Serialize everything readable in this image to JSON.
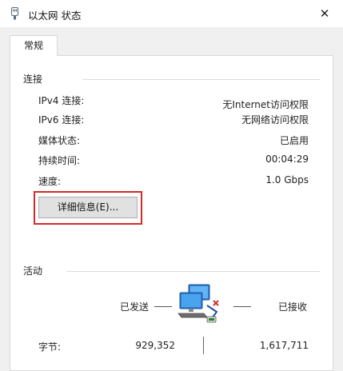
{
  "window": {
    "title": "以太网 状态",
    "close_glyph": "✕"
  },
  "tabs": [
    {
      "label": "常规"
    }
  ],
  "connection": {
    "section_title": "连接",
    "rows": [
      {
        "label": "IPv4 连接:",
        "value": "无Internet访问权限"
      },
      {
        "label": "IPv6 连接:",
        "value": "无网络访问权限"
      },
      {
        "label": "媒体状态:",
        "value": "已启用"
      },
      {
        "label": "持续时间:",
        "value": "00:04:29"
      },
      {
        "label": "速度:",
        "value": "1.0 Gbps"
      }
    ],
    "details_button": "详细信息(E)..."
  },
  "activity": {
    "section_title": "活动",
    "sent_label": "已发送",
    "received_label": "已接收",
    "bytes_label": "字节:",
    "bytes_sent": "929,352",
    "bytes_received": "1,617,711"
  },
  "colors": {
    "highlight": "#d32a2a",
    "panel_bg": "#f0f0f0"
  },
  "icons": {
    "title": "network-adapter-icon",
    "activity": "network-computers-icon"
  }
}
